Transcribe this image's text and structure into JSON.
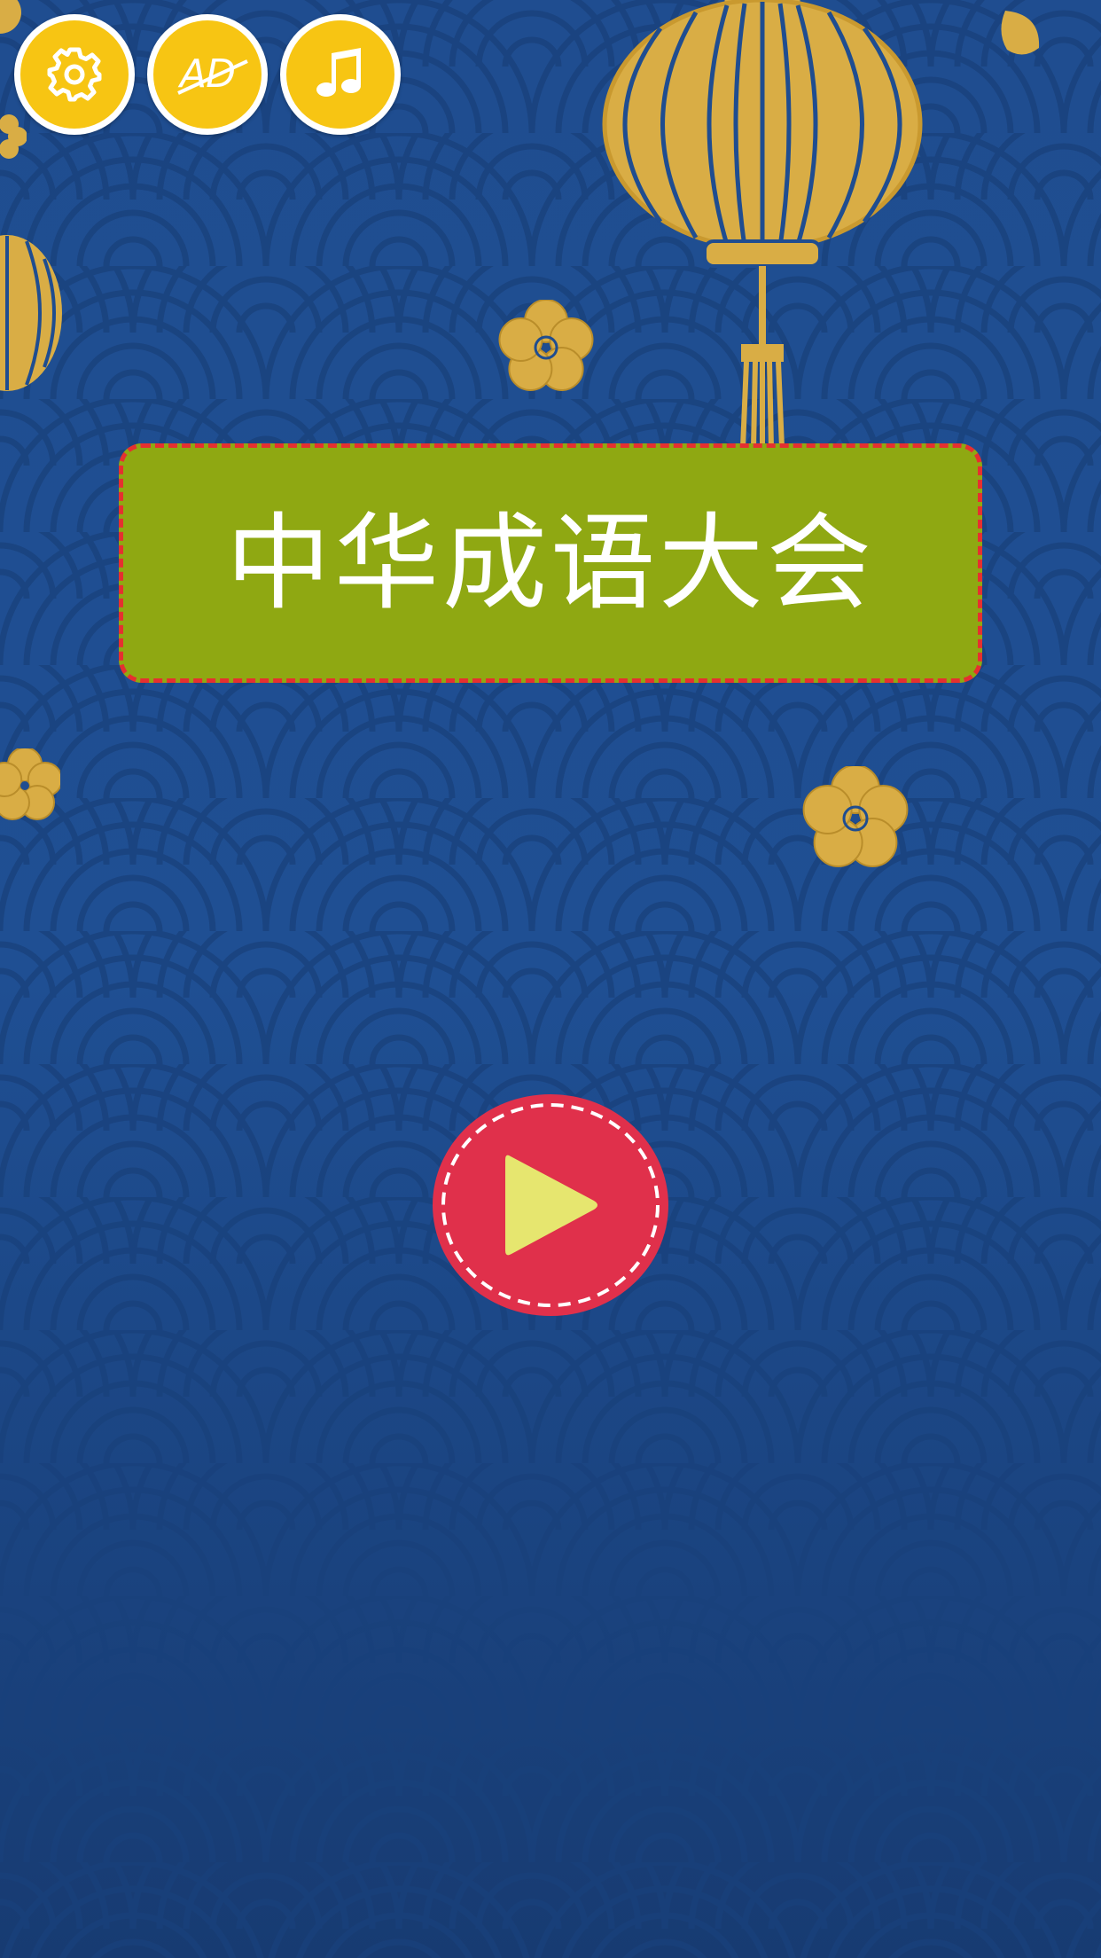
{
  "top_bar": {
    "settings": {
      "icon": "gear-icon",
      "label": ""
    },
    "remove_ads": {
      "icon": "no-ad-icon",
      "label": "AD"
    },
    "music": {
      "icon": "music-note-icon",
      "label": ""
    }
  },
  "title": {
    "text": "中华成语大会"
  },
  "play": {
    "icon": "play-icon"
  },
  "colors": {
    "background_top": "#1f4c8f",
    "background_bottom": "#163a70",
    "button_yellow": "#f7c513",
    "title_box": "#8fa812",
    "title_border": "#e53030",
    "play_red": "#e0304b",
    "play_triangle": "#e6e66f",
    "gold": "#d9ad45"
  }
}
